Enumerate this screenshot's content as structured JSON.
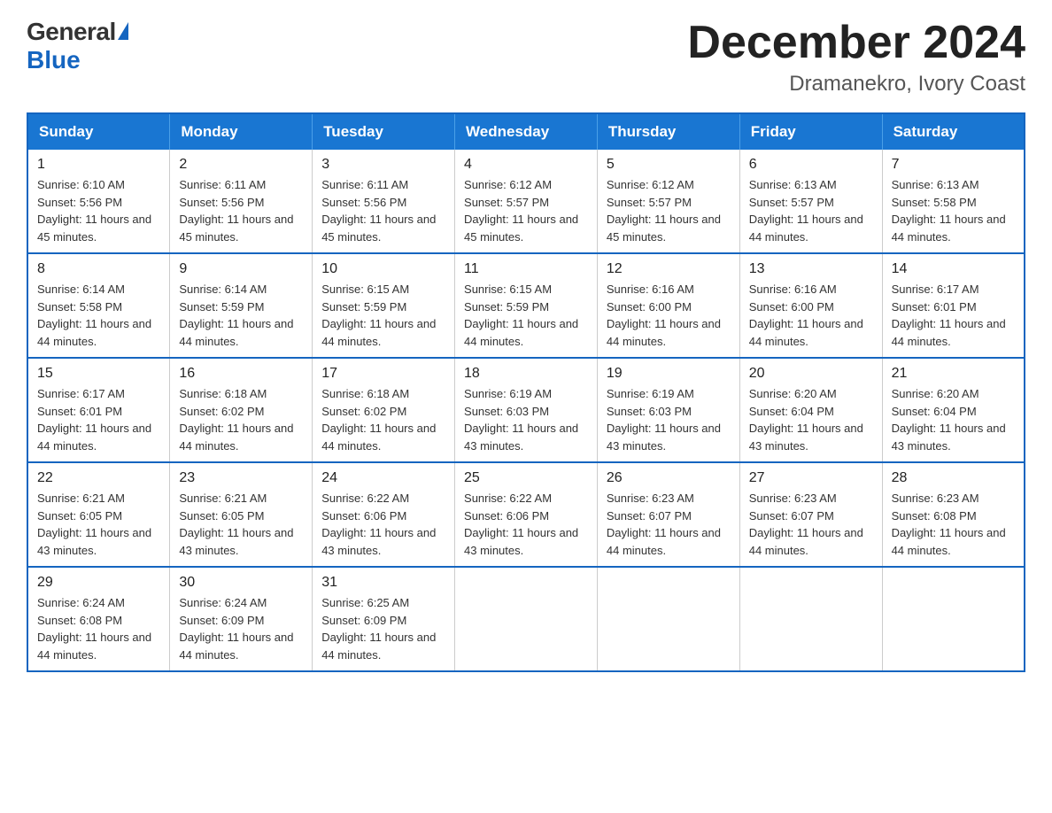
{
  "logo": {
    "general": "General",
    "blue": "Blue"
  },
  "title": "December 2024",
  "subtitle": "Dramanekro, Ivory Coast",
  "days_of_week": [
    "Sunday",
    "Monday",
    "Tuesday",
    "Wednesday",
    "Thursday",
    "Friday",
    "Saturday"
  ],
  "weeks": [
    [
      {
        "day": "1",
        "sunrise": "6:10 AM",
        "sunset": "5:56 PM",
        "daylight": "11 hours and 45 minutes."
      },
      {
        "day": "2",
        "sunrise": "6:11 AM",
        "sunset": "5:56 PM",
        "daylight": "11 hours and 45 minutes."
      },
      {
        "day": "3",
        "sunrise": "6:11 AM",
        "sunset": "5:56 PM",
        "daylight": "11 hours and 45 minutes."
      },
      {
        "day": "4",
        "sunrise": "6:12 AM",
        "sunset": "5:57 PM",
        "daylight": "11 hours and 45 minutes."
      },
      {
        "day": "5",
        "sunrise": "6:12 AM",
        "sunset": "5:57 PM",
        "daylight": "11 hours and 45 minutes."
      },
      {
        "day": "6",
        "sunrise": "6:13 AM",
        "sunset": "5:57 PM",
        "daylight": "11 hours and 44 minutes."
      },
      {
        "day": "7",
        "sunrise": "6:13 AM",
        "sunset": "5:58 PM",
        "daylight": "11 hours and 44 minutes."
      }
    ],
    [
      {
        "day": "8",
        "sunrise": "6:14 AM",
        "sunset": "5:58 PM",
        "daylight": "11 hours and 44 minutes."
      },
      {
        "day": "9",
        "sunrise": "6:14 AM",
        "sunset": "5:59 PM",
        "daylight": "11 hours and 44 minutes."
      },
      {
        "day": "10",
        "sunrise": "6:15 AM",
        "sunset": "5:59 PM",
        "daylight": "11 hours and 44 minutes."
      },
      {
        "day": "11",
        "sunrise": "6:15 AM",
        "sunset": "5:59 PM",
        "daylight": "11 hours and 44 minutes."
      },
      {
        "day": "12",
        "sunrise": "6:16 AM",
        "sunset": "6:00 PM",
        "daylight": "11 hours and 44 minutes."
      },
      {
        "day": "13",
        "sunrise": "6:16 AM",
        "sunset": "6:00 PM",
        "daylight": "11 hours and 44 minutes."
      },
      {
        "day": "14",
        "sunrise": "6:17 AM",
        "sunset": "6:01 PM",
        "daylight": "11 hours and 44 minutes."
      }
    ],
    [
      {
        "day": "15",
        "sunrise": "6:17 AM",
        "sunset": "6:01 PM",
        "daylight": "11 hours and 44 minutes."
      },
      {
        "day": "16",
        "sunrise": "6:18 AM",
        "sunset": "6:02 PM",
        "daylight": "11 hours and 44 minutes."
      },
      {
        "day": "17",
        "sunrise": "6:18 AM",
        "sunset": "6:02 PM",
        "daylight": "11 hours and 44 minutes."
      },
      {
        "day": "18",
        "sunrise": "6:19 AM",
        "sunset": "6:03 PM",
        "daylight": "11 hours and 43 minutes."
      },
      {
        "day": "19",
        "sunrise": "6:19 AM",
        "sunset": "6:03 PM",
        "daylight": "11 hours and 43 minutes."
      },
      {
        "day": "20",
        "sunrise": "6:20 AM",
        "sunset": "6:04 PM",
        "daylight": "11 hours and 43 minutes."
      },
      {
        "day": "21",
        "sunrise": "6:20 AM",
        "sunset": "6:04 PM",
        "daylight": "11 hours and 43 minutes."
      }
    ],
    [
      {
        "day": "22",
        "sunrise": "6:21 AM",
        "sunset": "6:05 PM",
        "daylight": "11 hours and 43 minutes."
      },
      {
        "day": "23",
        "sunrise": "6:21 AM",
        "sunset": "6:05 PM",
        "daylight": "11 hours and 43 minutes."
      },
      {
        "day": "24",
        "sunrise": "6:22 AM",
        "sunset": "6:06 PM",
        "daylight": "11 hours and 43 minutes."
      },
      {
        "day": "25",
        "sunrise": "6:22 AM",
        "sunset": "6:06 PM",
        "daylight": "11 hours and 43 minutes."
      },
      {
        "day": "26",
        "sunrise": "6:23 AM",
        "sunset": "6:07 PM",
        "daylight": "11 hours and 44 minutes."
      },
      {
        "day": "27",
        "sunrise": "6:23 AM",
        "sunset": "6:07 PM",
        "daylight": "11 hours and 44 minutes."
      },
      {
        "day": "28",
        "sunrise": "6:23 AM",
        "sunset": "6:08 PM",
        "daylight": "11 hours and 44 minutes."
      }
    ],
    [
      {
        "day": "29",
        "sunrise": "6:24 AM",
        "sunset": "6:08 PM",
        "daylight": "11 hours and 44 minutes."
      },
      {
        "day": "30",
        "sunrise": "6:24 AM",
        "sunset": "6:09 PM",
        "daylight": "11 hours and 44 minutes."
      },
      {
        "day": "31",
        "sunrise": "6:25 AM",
        "sunset": "6:09 PM",
        "daylight": "11 hours and 44 minutes."
      },
      null,
      null,
      null,
      null
    ]
  ]
}
